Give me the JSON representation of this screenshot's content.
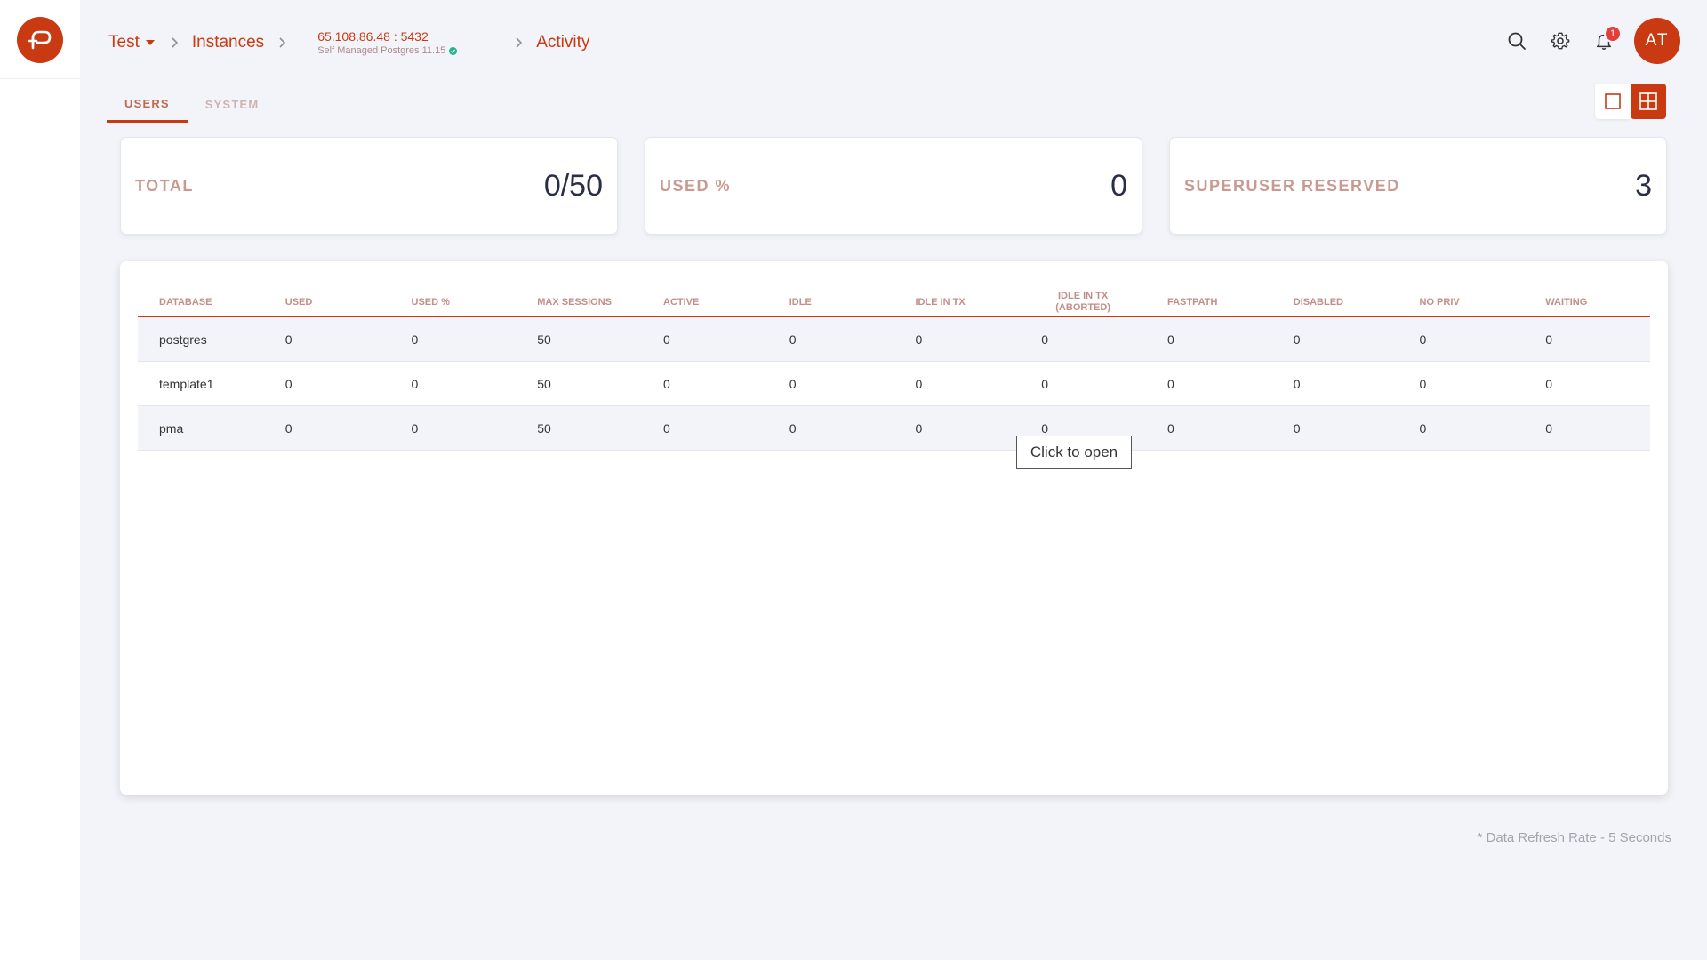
{
  "breadcrumb": {
    "project": "Test",
    "instances": "Instances",
    "instance_host": "65.108.86.48 : 5432",
    "instance_type": "Self Managed Postgres 11.15",
    "current": "Activity"
  },
  "topbar": {
    "notification_count": "1",
    "avatar_initials": "AT"
  },
  "tabs": [
    {
      "label": "USERS",
      "active": true
    },
    {
      "label": "SYSTEM",
      "active": false
    }
  ],
  "stats": [
    {
      "label": "TOTAL",
      "value": "0/50"
    },
    {
      "label": "USED %",
      "value": "0"
    },
    {
      "label": "SUPERUSER RESERVED",
      "value": "3"
    }
  ],
  "table": {
    "headers": [
      "DATABASE",
      "USED",
      "USED %",
      "MAX SESSIONS",
      "ACTIVE",
      "IDLE",
      "IDLE IN TX",
      "IDLE IN TX (ABORTED)",
      "FASTPATH",
      "DISABLED",
      "NO PRIV",
      "WAITING"
    ],
    "rows": [
      [
        "postgres",
        "0",
        "0",
        "50",
        "0",
        "0",
        "0",
        "0",
        "0",
        "0",
        "0",
        "0"
      ],
      [
        "template1",
        "0",
        "0",
        "50",
        "0",
        "0",
        "0",
        "0",
        "0",
        "0",
        "0",
        "0"
      ],
      [
        "pma",
        "0",
        "0",
        "50",
        "0",
        "0",
        "0",
        "0",
        "0",
        "0",
        "0",
        "0"
      ]
    ]
  },
  "tooltip": "Click to open",
  "footer_note": "* Data Refresh Rate - 5 Seconds",
  "colors": {
    "accent": "#c93a12",
    "label": "#c99a92",
    "background": "#f2f4f9",
    "badge": "#e53d3a",
    "ok": "#1fb58a"
  },
  "icons": [
    "app-logo-icon",
    "chevron-right-icon",
    "caret-down-icon",
    "check-circle-icon",
    "search-icon",
    "gear-icon",
    "bell-icon",
    "single-view-icon",
    "grid-view-icon"
  ]
}
